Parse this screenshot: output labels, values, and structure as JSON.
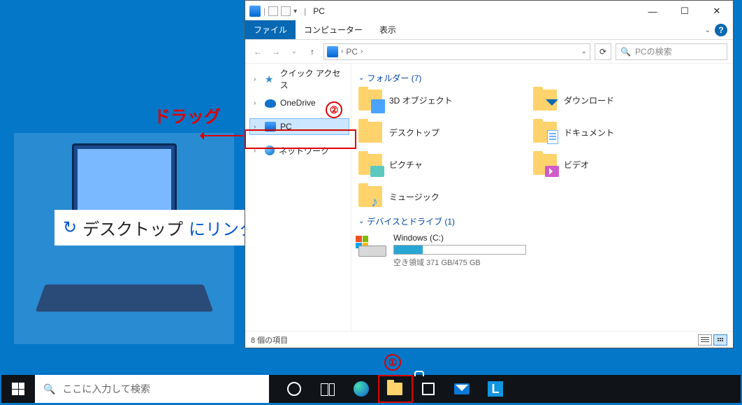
{
  "annotations": {
    "drag_label": "ドラッグ",
    "callout1": "①",
    "callout2": "②",
    "tooltip_text1": "デスクトップ",
    "tooltip_text2": "にリンクを"
  },
  "window": {
    "title": "PC",
    "ribbon": {
      "file": "ファイル",
      "computer": "コンピューター",
      "view": "表示"
    },
    "crumb": "PC",
    "crumb_caret": "›",
    "search_placeholder": "PCの検索"
  },
  "tree": {
    "quick_access": "クイック アクセス",
    "onedrive": "OneDrive",
    "pc": "PC",
    "network": "ネットワーク"
  },
  "groups": {
    "folders_header": "フォルダー (7)",
    "drives_header": "デバイスとドライブ (1)"
  },
  "folders": {
    "obj3d": "3D オブジェクト",
    "downloads": "ダウンロード",
    "desktop": "デスクトップ",
    "documents": "ドキュメント",
    "pictures": "ピクチャ",
    "videos": "ビデオ",
    "music": "ミュージック"
  },
  "drive": {
    "label": "Windows (C:)",
    "free_text": "空き領域 371 GB/475 GB",
    "fill_percent": 22
  },
  "status": {
    "items": "8 個の項目"
  },
  "taskbar": {
    "search_placeholder": "ここに入力して検索"
  }
}
